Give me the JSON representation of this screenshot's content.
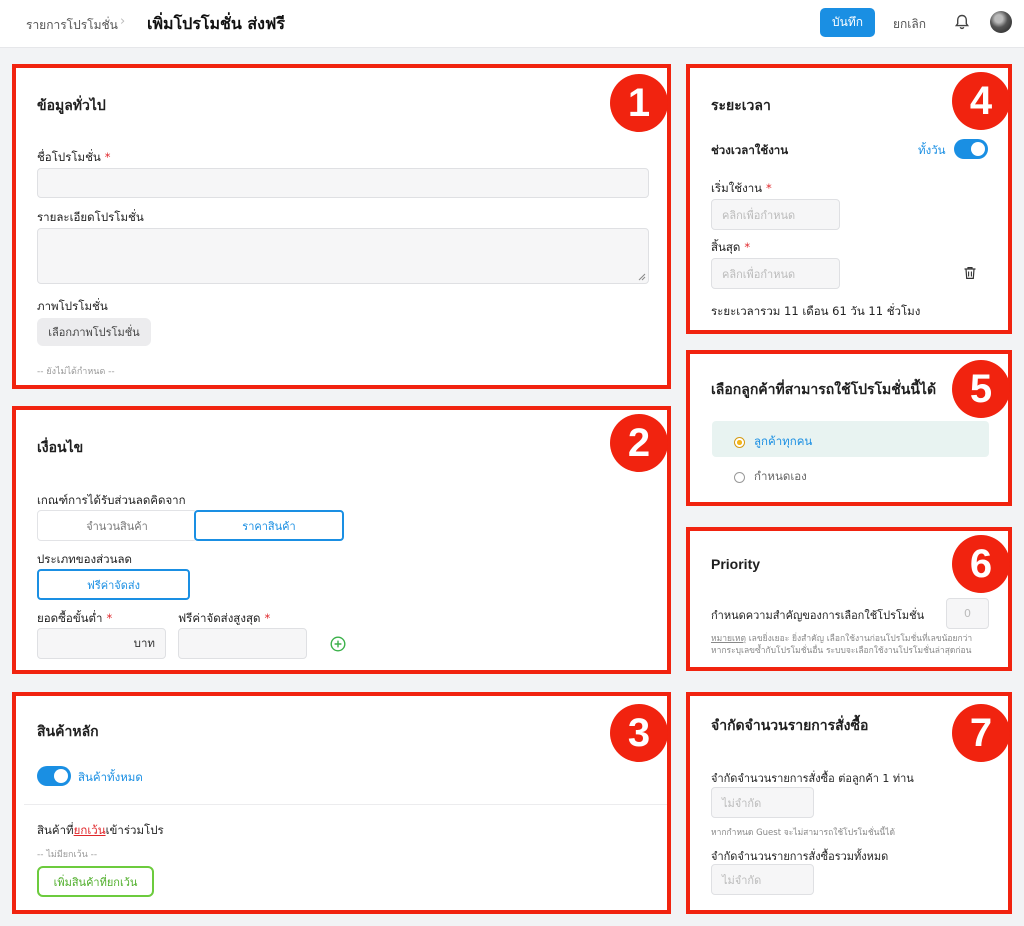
{
  "header": {
    "breadcrumb": "รายการโปรโมชั่น",
    "breadcrumb_sep": "›",
    "title": "เพิ่มโปรโมชั่น ส่งฟรี",
    "save_label": "บันทึก",
    "cancel_label": "ยกเลิก"
  },
  "badges": [
    "1",
    "2",
    "3",
    "4",
    "5",
    "6",
    "7"
  ],
  "general": {
    "title": "ข้อมูลทั่วไป",
    "name_label": "ชื่อโปรโมชั่น",
    "required_mark": "*",
    "detail_label": "รายละเอียดโปรโมชั่น",
    "image_label": "ภาพโปรโมชั่น",
    "image_button": "เลือกภาพโปรโมชั่น",
    "not_set": "-- ยังไม่ได้กำหนด --"
  },
  "conditions": {
    "title": "เงื่อนไข",
    "criteria_label": "เกณฑ์การได้รับส่วนลดคิดจาก",
    "criteria_options": [
      "จำนวนสินค้า",
      "ราคาสินค้า"
    ],
    "criteria_selected": "ราคาสินค้า",
    "discount_type_label": "ประเภทของส่วนลด",
    "discount_type_value": "ฟรีค่าจัดส่ง",
    "min_purchase_label": "ยอดซื้อขั้นต่ำ",
    "min_purchase_unit": "บาท",
    "max_shipping_label": "ฟรีค่าจัดส่งสูงสุด"
  },
  "products": {
    "title": "สินค้าหลัก",
    "all_products_label": "สินค้าทั้งหมด",
    "all_products_on": true,
    "excluded_prefix": "สินค้าที่",
    "excluded_highlight": "ยกเว้น",
    "excluded_suffix": "เข้าร่วมโปร",
    "none_excluded": "-- ไม่มียกเว้น --",
    "add_excluded_button": "เพิ่มสินค้าที่ยกเว้น"
  },
  "period": {
    "title": "ระยะเวลา",
    "active_label": "ช่วงเวลาใช้งาน",
    "all_day_label": "ทั้งวัน",
    "all_day_on": true,
    "start_label": "เริ่มใช้งาน",
    "start_placeholder": "คลิกเพื่อกำหนด",
    "end_label": "สิ้นสุด",
    "end_placeholder": "คลิกเพื่อกำหนด",
    "total": "ระยะเวลารวม 11 เดือน 61 วัน 11 ชั่วโมง"
  },
  "customers": {
    "title": "เลือกลูกค้าที่สามารถใช้โปรโมชั่นนี้ได้",
    "options": [
      "ลูกค้าทุกคน",
      "กำหนดเอง"
    ],
    "selected": "ลูกค้าทุกคน"
  },
  "priority": {
    "title": "Priority",
    "label": "กำหนดความสำคัญของการเลือกใช้โปรโมชั่น",
    "placeholder": "0",
    "note_head": "หมายเหตุ",
    "note_line1": "เลขยิ่งเยอะ ยิ่งสำคัญ เลือกใช้งานก่อนโปรโมชั่นที่เลขน้อยกว่า",
    "note_line2": "หากระบุเลขซ้ำกับโปรโมชั่นอื่น ระบบจะเลือกใช้งานโปรโมชั่นล่าสุดก่อน"
  },
  "order_limit": {
    "title": "จำกัดจำนวนรายการสั่งซื้อ",
    "per_customer_label": "จำกัดจำนวนรายการสั่งซื้อ ต่อลูกค้า 1 ท่าน",
    "per_customer_placeholder": "ไม่จำกัด",
    "guest_note": "หากกำหนด Guest จะไม่สามารถใช้โปรโมชั่นนี้ได้",
    "total_label": "จำกัดจำนวนรายการสั่งซื้อรวมทั้งหมด",
    "total_placeholder": "ไม่จำกัด"
  },
  "colors": {
    "accent": "#1a8fe3",
    "highlight_box": "#f1230f",
    "required": "#e0262a",
    "success": "#3bb14a"
  },
  "icons": [
    "bell-icon",
    "avatar",
    "trash-icon",
    "add-circle-icon"
  ]
}
